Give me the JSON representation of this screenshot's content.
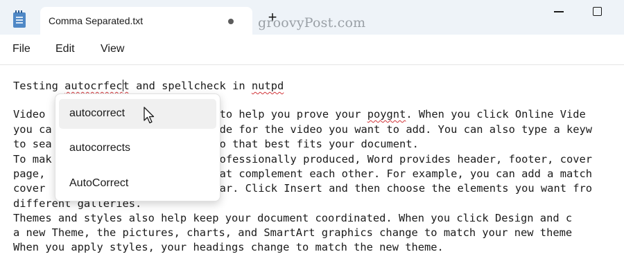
{
  "window": {
    "tab_title": "Comma Separated.txt",
    "new_tab_glyph": "+",
    "watermark": "groovyPost.com",
    "icons": [
      "notepad-icon",
      "unsaved-dot-icon",
      "minimize-icon",
      "maximize-icon"
    ]
  },
  "menu": {
    "items": [
      {
        "label": "File"
      },
      {
        "label": "Edit"
      },
      {
        "label": "View"
      }
    ]
  },
  "editor": {
    "line1": {
      "pre": "Testing ",
      "word_before_caret": "autocrfec",
      "word_after_caret": "t",
      "mid": " and spellcheck in ",
      "word2": "nutpd"
    },
    "line2": {
      "a": "Video ",
      "b": "to help you prove your ",
      "miss": "poygnt",
      "c": ". When you click Online Vide"
    },
    "line3": {
      "a": "you ca",
      "b": "de for the video you want to add. You can also type a keyw"
    },
    "line4": {
      "a": "to sea",
      "b": "o that best fits your document."
    },
    "line5": {
      "a": "To mak",
      "b": "ofessionally produced, Word provides header, footer, cover"
    },
    "line6": {
      "a": "page, ",
      "b": "at complement each other. For example, you can add a match"
    },
    "line7": {
      "a": "cover ",
      "b": "ar. Click Insert and then choose the elements you want fro"
    },
    "line8": "different galleries.",
    "line9": "Themes and styles also help keep your document coordinated. When you click Design and c",
    "line10": "a new Theme, the pictures, charts, and SmartArt graphics change to match your new theme",
    "line11": "When you apply styles, your headings change to match the new theme."
  },
  "suggestions": {
    "items": [
      {
        "label": "autocorrect"
      },
      {
        "label": "autocorrects"
      },
      {
        "label": "AutoCorrect"
      }
    ],
    "highlighted_index": 0
  },
  "colors": {
    "titlebar_bg": "#eef3f8",
    "spell_underline": "#d13438",
    "highlight_bg": "#f0f0f0"
  }
}
